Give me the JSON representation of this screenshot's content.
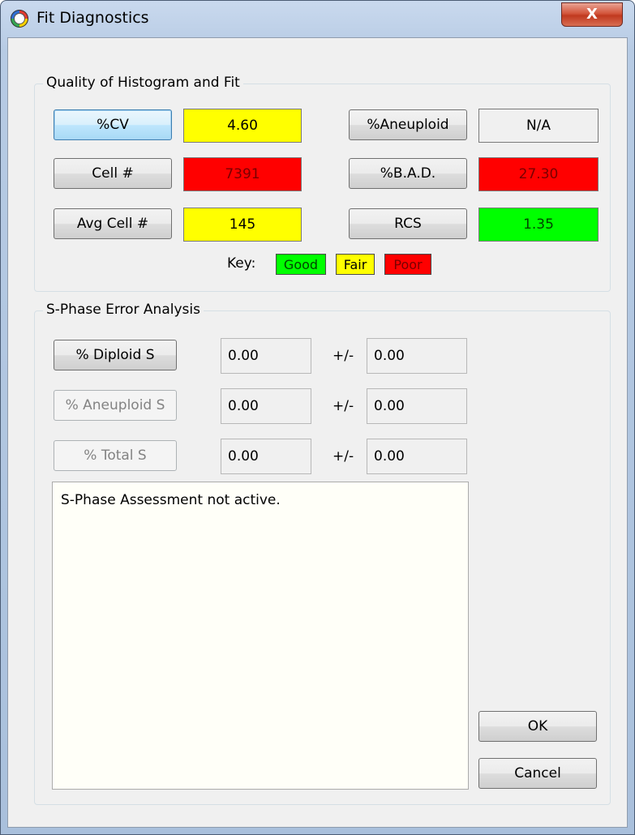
{
  "window": {
    "title": "Fit Diagnostics",
    "close_label": "X"
  },
  "quality": {
    "group_title": "Quality of Histogram and Fit",
    "cv_button": "%CV",
    "cv_value": "4.60",
    "aneuploid_button": "%Aneuploid",
    "aneuploid_value": "N/A",
    "cell_button": "Cell #",
    "cell_value": "7391",
    "bad_button": "%B.A.D.",
    "bad_value": "27.30",
    "avg_cell_button": "Avg Cell #",
    "avg_cell_value": "145",
    "rcs_button": "RCS",
    "rcs_value": "1.35",
    "key_label": "Key:",
    "key_good": "Good",
    "key_fair": "Fair",
    "key_poor": "Poor",
    "colors": {
      "good": "#00ff00",
      "fair": "#ffff00",
      "poor": "#ff0000"
    }
  },
  "sphase": {
    "group_title": "S-Phase Error Analysis",
    "rows": [
      {
        "label": "% Diploid S",
        "value": "0.00",
        "pm": "+/-",
        "error": "0.00",
        "enabled": true
      },
      {
        "label": "% Aneuploid S",
        "value": "0.00",
        "pm": "+/-",
        "error": "0.00",
        "enabled": false
      },
      {
        "label": "% Total S",
        "value": "0.00",
        "pm": "+/-",
        "error": "0.00",
        "enabled": false
      }
    ],
    "assessment_text": "S-Phase Assessment not active."
  },
  "buttons": {
    "ok": "OK",
    "cancel": "Cancel"
  }
}
